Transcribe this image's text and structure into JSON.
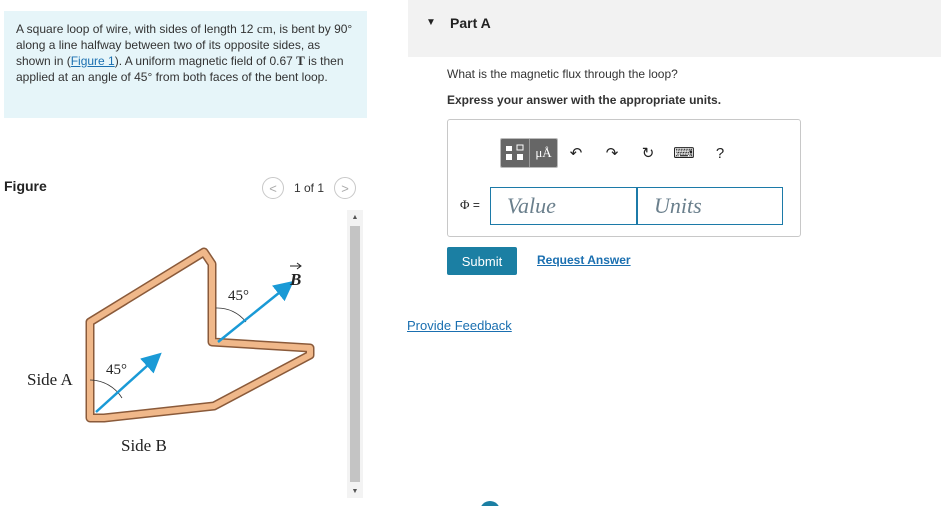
{
  "problem": {
    "text_1": "A square loop of wire, with sides of length 12 ",
    "length_unit": "cm",
    "text_2": ", is bent by 90° along a line halfway between two of its opposite sides, as shown in (",
    "figure_link": "Figure 1",
    "text_3": "). A uniform magnetic field of 0.67 ",
    "field_unit": "T",
    "text_4": " is then applied at an angle of 45° from both faces of the bent loop."
  },
  "figure": {
    "title": "Figure",
    "pager_prev": "<",
    "pager_count": "1 of 1",
    "pager_next": ">",
    "label_side_a": "Side A",
    "label_side_b": "Side B",
    "label_angle_1": "45°",
    "label_angle_2": "45°",
    "label_field": "B",
    "loop_color": "#f0b88a",
    "arrow_color": "#1a9ad6"
  },
  "part": {
    "toggle": "▼",
    "title": "Part A",
    "question": "What is the magnetic flux through the loop?",
    "instruction": "Express your answer with the appropriate units."
  },
  "toolbar": {
    "units_btn": "μÅ",
    "undo": "↶",
    "redo": "↷",
    "reset": "↻",
    "keyboard": "⌨",
    "help": "?"
  },
  "answer": {
    "symbol": "Φ",
    "equals": " =",
    "value_placeholder": "Value",
    "units_placeholder": "Units"
  },
  "actions": {
    "submit": "Submit",
    "request_answer": "Request Answer",
    "provide_feedback": "Provide Feedback"
  }
}
